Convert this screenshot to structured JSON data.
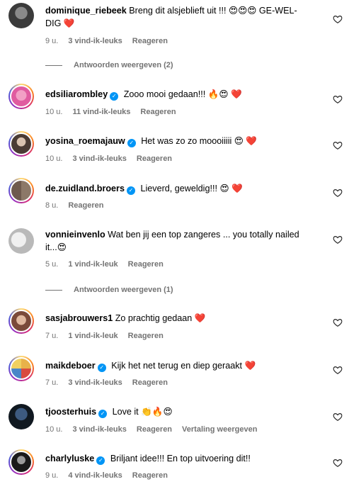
{
  "comments": [
    {
      "username": "dominique_riebeek",
      "verified": false,
      "text": "Breng dit alsjeblieft uit !!! 😍😍😍 GE-WEL-DIG",
      "heart": "❤️",
      "time": "9 u.",
      "likes": "3 vind-ik-leuks",
      "reply": "Reageren",
      "view_replies": "Antwoorden weergeven (2)"
    },
    {
      "username": "edsiliarombley",
      "verified": true,
      "text": "Zooo mooi gedaan!!! 🔥😍",
      "heart": "❤️",
      "time": "10 u.",
      "likes": "11 vind-ik-leuks",
      "reply": "Reageren"
    },
    {
      "username": "yosina_roemajauw",
      "verified": true,
      "text": "Het was zo zo moooiiiii 😍",
      "heart": "❤️",
      "time": "10 u.",
      "likes": "3 vind-ik-leuks",
      "reply": "Reageren"
    },
    {
      "username": "de.zuidland.broers",
      "verified": true,
      "text": "Lieverd, geweldig!!! 😍",
      "heart": "❤️",
      "time": "8 u.",
      "reply": "Reageren"
    },
    {
      "username": "vonnieinvenlo",
      "verified": false,
      "text": "Wat ben jij een top zangeres ... you totally nailed it...😍",
      "time": "5 u.",
      "likes": "1 vind-ik-leuk",
      "reply": "Reageren",
      "view_replies": "Antwoorden weergeven (1)"
    },
    {
      "username": "sasjabrouwers1",
      "verified": false,
      "text": "Zo prachtig gedaan",
      "heart": "❤️",
      "time": "7 u.",
      "likes": "1 vind-ik-leuk",
      "reply": "Reageren"
    },
    {
      "username": "maikdeboer",
      "verified": true,
      "text": "Kijk het net terug en diep geraakt",
      "heart": "❤️",
      "time": "7 u.",
      "likes": "3 vind-ik-leuks",
      "reply": "Reageren"
    },
    {
      "username": "tjoosterhuis",
      "verified": true,
      "text": "Love it 👏🔥😍",
      "time": "10 u.",
      "likes": "3 vind-ik-leuks",
      "reply": "Reageren",
      "translate": "Vertaling weergeven"
    },
    {
      "username": "charlyluske",
      "verified": true,
      "text": "Briljant idee!!! En top uitvoering dit!!",
      "time": "9 u.",
      "likes": "4 vind-ik-leuks",
      "reply": "Reageren"
    }
  ],
  "icons": {
    "verified": "verified-badge-icon",
    "like": "heart-outline-icon"
  },
  "colors": {
    "verified": "#0095f6",
    "heart": "#ed1c24",
    "meta": "#737373"
  }
}
